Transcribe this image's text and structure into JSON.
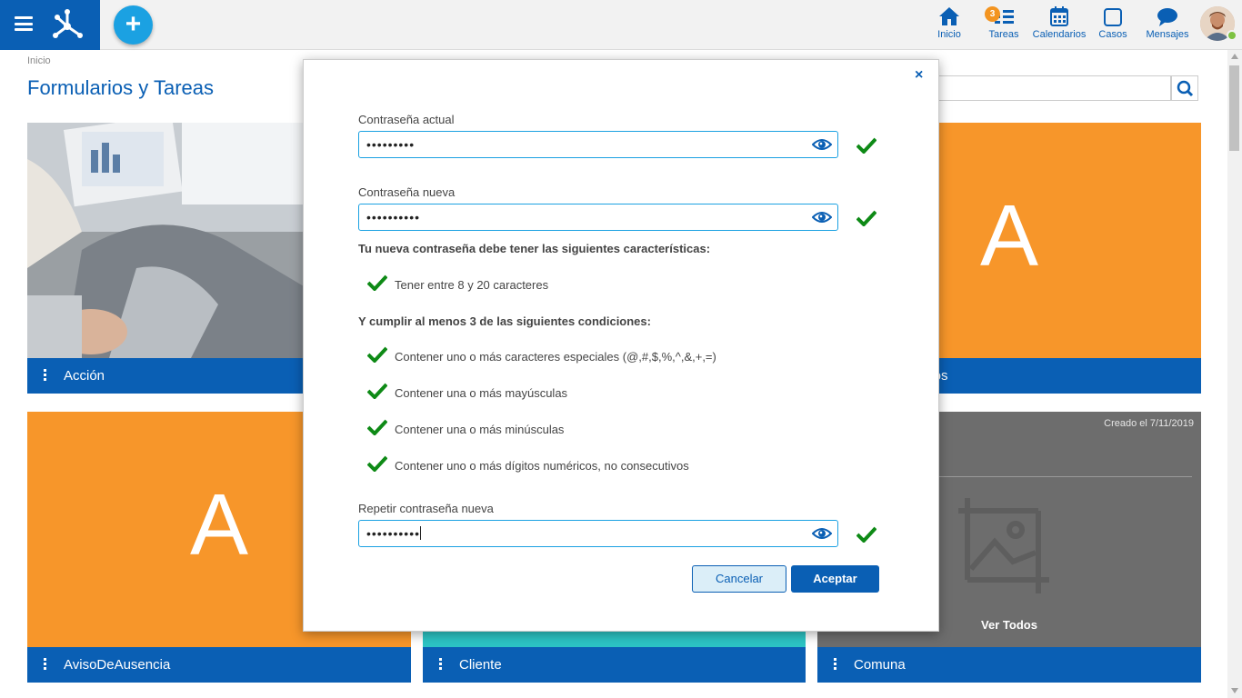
{
  "topbar": {
    "add_symbol": "+",
    "nav": [
      {
        "label": "Inicio",
        "icon": "home-icon"
      },
      {
        "label": "Tareas",
        "icon": "tasks-icon",
        "badge": "3"
      },
      {
        "label": "Calendarios",
        "icon": "calendar-icon"
      },
      {
        "label": "Casos",
        "icon": "cases-icon"
      },
      {
        "label": "Mensajes",
        "icon": "messages-icon"
      }
    ]
  },
  "page": {
    "breadcrumb": "Inicio",
    "title": "Formularios y Tareas"
  },
  "cards": [
    {
      "label": "Acción"
    },
    {
      "label": "stos",
      "letter": "A"
    },
    {
      "label": "AvisoDeAusencia",
      "letter": "A"
    },
    {
      "label": "Cliente"
    },
    {
      "label": "Comuna",
      "created": "Creado el 7/11/2019",
      "see_all": "Ver Todos"
    }
  ],
  "modal": {
    "close": "×",
    "current_label": "Contraseña actual",
    "current_value": "•••••••••",
    "new_label": "Contraseña nueva",
    "new_value": "••••••••••",
    "must_have": "Tu nueva contraseña debe tener las siguientes características:",
    "req_length": "Tener entre 8 y 20 caracteres",
    "at_least": "Y cumplir al menos 3 de las siguientes condiciones:",
    "req_special": "Contener uno o más caracteres especiales (@,#,$,%,^,&,+,=)",
    "req_upper": "Contener una o más mayúsculas",
    "req_lower": "Contener una o más minúsculas",
    "req_digits": "Contener uno o más dígitos numéricos, no consecutivos",
    "repeat_label": "Repetir contraseña nueva",
    "repeat_value": "••••••••••",
    "cancel": "Cancelar",
    "accept": "Aceptar"
  },
  "colors": {
    "primary": "#0a5fb4",
    "accent": "#1ba1e2",
    "orange": "#f7962a",
    "teal": "#2cc5c5",
    "check": "#0e8a16"
  }
}
